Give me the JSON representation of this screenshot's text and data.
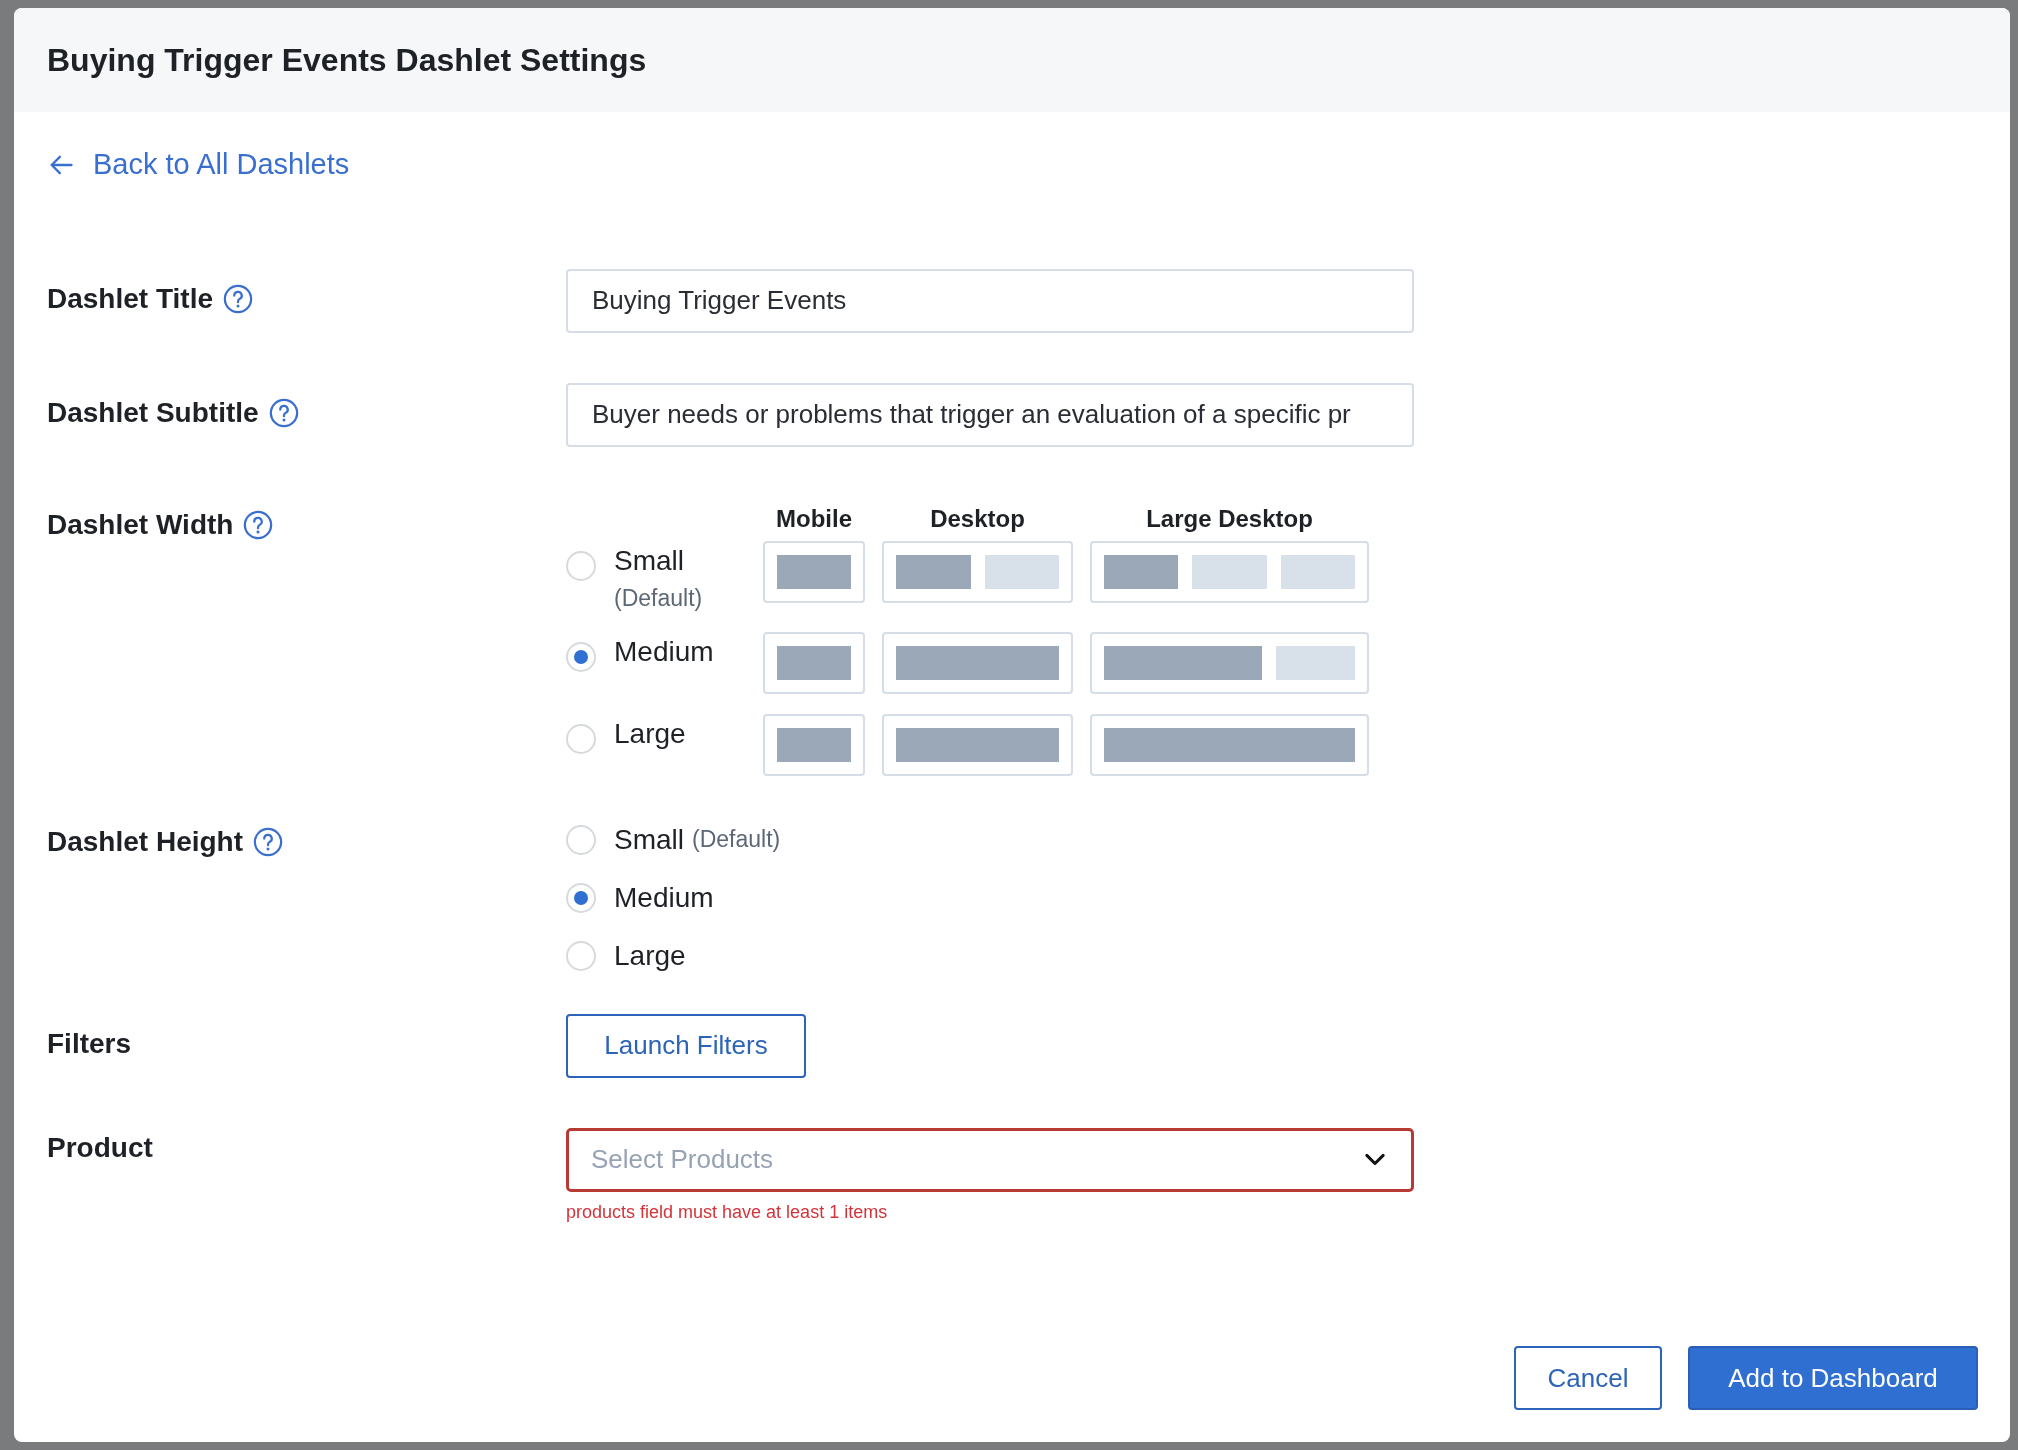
{
  "dialog": {
    "title": "Buying Trigger Events Dashlet Settings",
    "back_link": "Back to All Dashlets",
    "title_field": {
      "label": "Dashlet Title",
      "value": "Buying Trigger Events"
    },
    "subtitle_field": {
      "label": "Dashlet Subtitle",
      "value": "Buyer needs or problems that trigger an evaluation of a specific pr"
    },
    "width": {
      "label": "Dashlet Width",
      "devices": [
        "Mobile",
        "Desktop",
        "Large Desktop"
      ],
      "options": [
        {
          "label": "Small",
          "note": "(Default)",
          "selected": false,
          "previews": [
            {
              "columns": [
                {
                  "filled": true
                }
              ]
            },
            {
              "columns": [
                {
                  "filled": true
                },
                {
                  "filled": false
                }
              ]
            },
            {
              "columns": [
                {
                  "filled": true
                },
                {
                  "filled": false
                },
                {
                  "filled": false
                }
              ]
            }
          ]
        },
        {
          "label": "Medium",
          "selected": true,
          "previews": [
            {
              "columns": [
                {
                  "filled": true
                }
              ]
            },
            {
              "columns": [
                {
                  "filled": true
                },
                {
                  "filled": true
                }
              ]
            },
            {
              "columns": [
                {
                  "filled": true
                },
                {
                  "filled": true
                },
                {
                  "filled": false
                }
              ]
            }
          ]
        },
        {
          "label": "Large",
          "selected": false,
          "previews": [
            {
              "columns": [
                {
                  "filled": true
                }
              ]
            },
            {
              "columns": [
                {
                  "filled": true
                },
                {
                  "filled": true
                }
              ]
            },
            {
              "columns": [
                {
                  "filled": true
                },
                {
                  "filled": true
                },
                {
                  "filled": true
                }
              ]
            }
          ]
        }
      ]
    },
    "height": {
      "label": "Dashlet Height",
      "options": [
        {
          "label": "Small",
          "note": "(Default)",
          "selected": false
        },
        {
          "label": "Medium",
          "selected": true
        },
        {
          "label": "Large",
          "selected": false
        }
      ]
    },
    "filters": {
      "label": "Filters",
      "button": "Launch Filters"
    },
    "product": {
      "label": "Product",
      "placeholder": "Select Products",
      "error": "products field must have at least 1 items"
    },
    "buttons": [
      {
        "label": "Cancel",
        "kind": "secondary"
      },
      {
        "label": "Add to Dashboard",
        "kind": "primary"
      }
    ]
  }
}
